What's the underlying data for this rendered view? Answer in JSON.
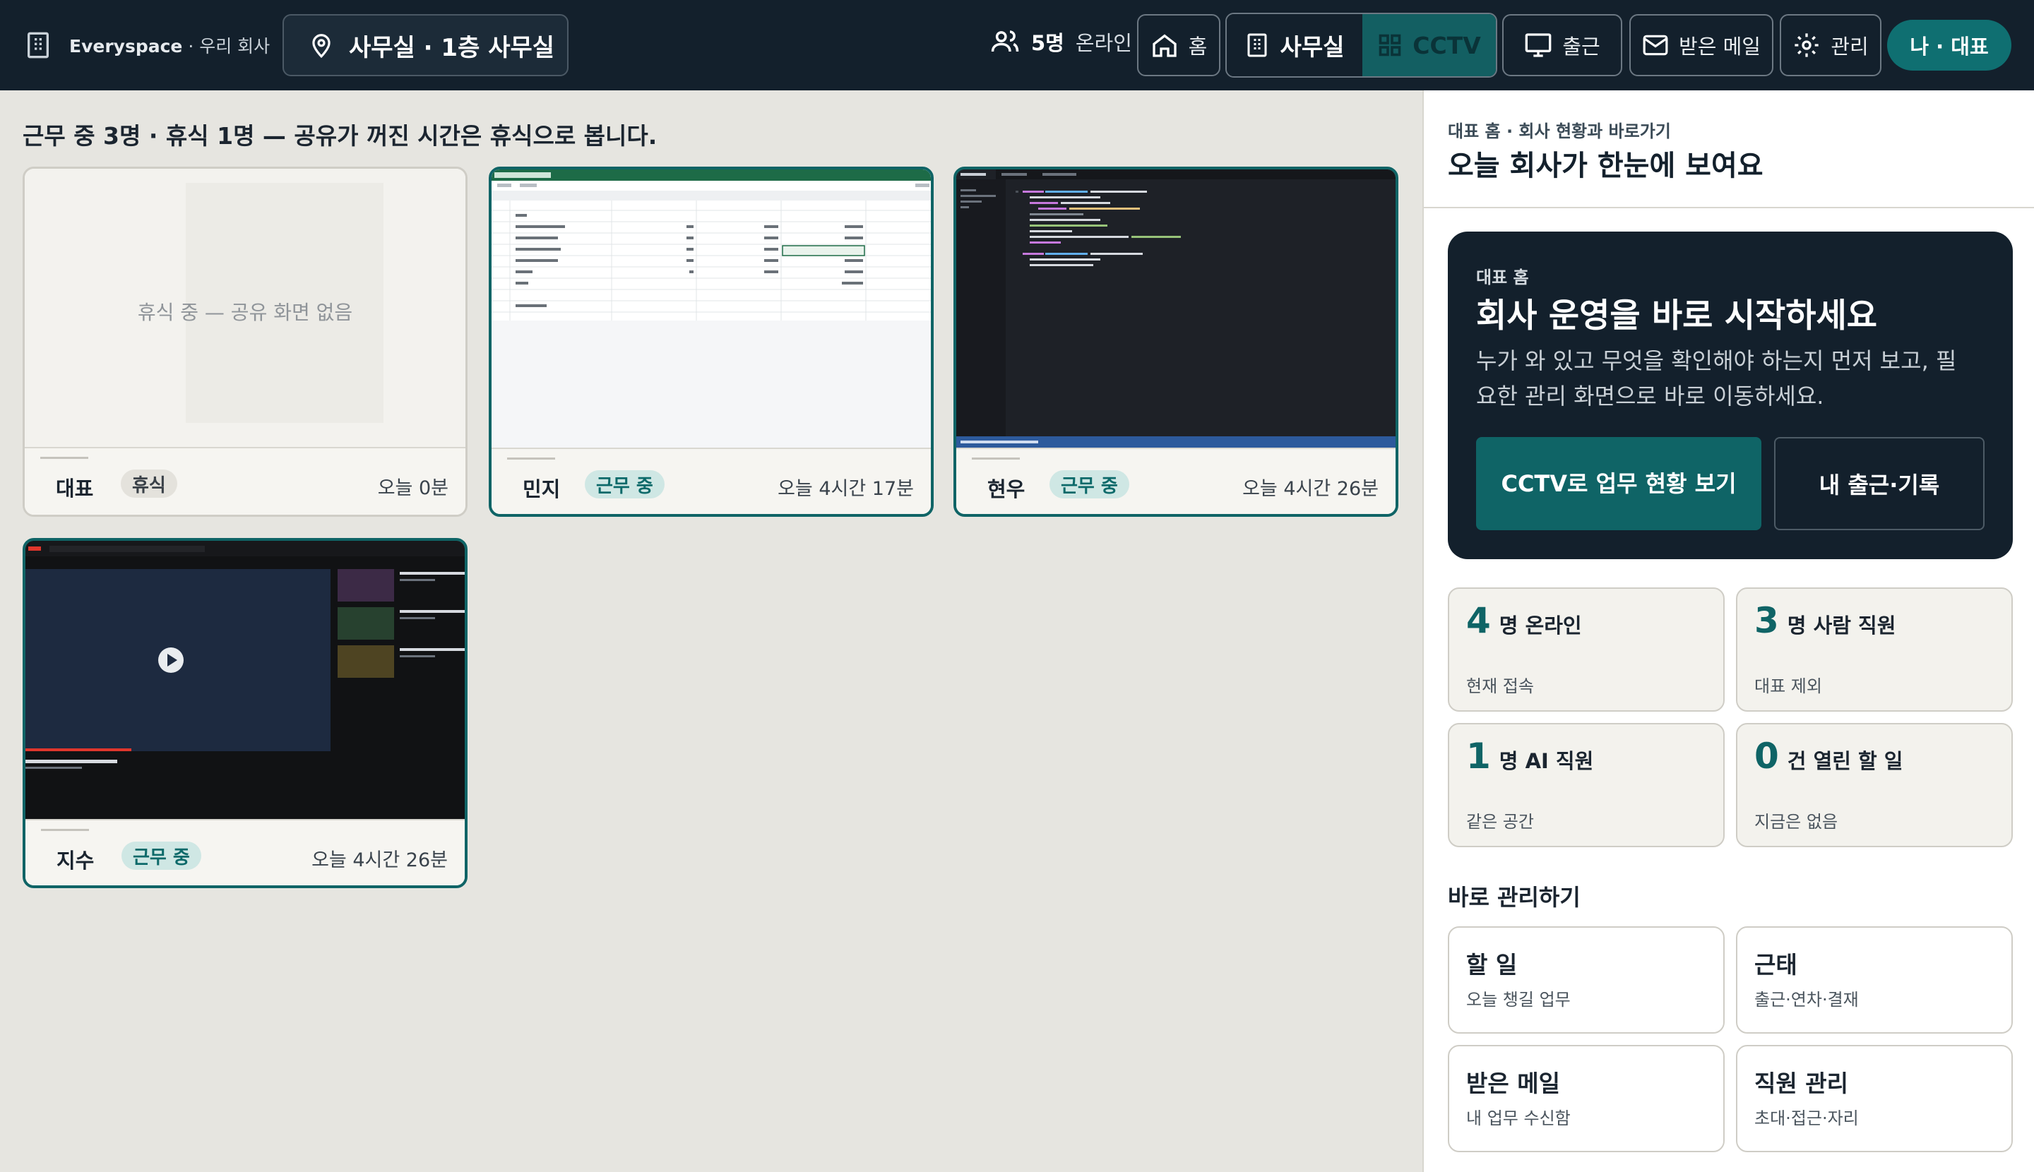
{
  "nav": {
    "brand_name": "Everyspace",
    "brand_sub": "· 우리 회사",
    "location_label": "사무실 · 1층 사무실",
    "online_count": "5명",
    "online_label": "온라인",
    "home_label": "홈",
    "office_label": "사무실",
    "cctv_label": "CCTV",
    "checkin_label": "출근",
    "inbox_label": "받은 메일",
    "admin_label": "관리",
    "me_label": "나 · 대표"
  },
  "main": {
    "headline": "근무 중 3명 · 휴식 1명 — 공유가 꺼진 시간은 휴식으로 봅니다.",
    "cards": [
      {
        "name": "대표",
        "status": "휴식",
        "time": "오늘 0분",
        "placeholder": "휴식 중 — 공유 화면 없음"
      },
      {
        "name": "민지",
        "status": "근무 중",
        "time": "오늘 4시간 17분"
      },
      {
        "name": "현우",
        "status": "근무 중",
        "time": "오늘 4시간 26분"
      },
      {
        "name": "지수",
        "status": "근무 중",
        "time": "오늘 4시간 26분"
      }
    ]
  },
  "side": {
    "breadcrumb": "대표 홈 · 회사 현황과 바로가기",
    "title": "오늘 회사가 한눈에 보여요",
    "hero": {
      "kicker": "대표 홈",
      "heading": "회사 운영을 바로 시작하세요",
      "desc": "누가 와 있고 무엇을 확인해야 하는지 먼저 보고, 필요한 관리 화면으로 바로 이동하세요.",
      "primary": "CCTV로 업무 현황 보기",
      "secondary": "내 출근·기록"
    },
    "stats": [
      {
        "value": "4",
        "label": "명 온라인",
        "sub": "현재 접속"
      },
      {
        "value": "3",
        "label": "명 사람 직원",
        "sub": "대표 제외"
      },
      {
        "value": "1",
        "label": "명 AI 직원",
        "sub": "같은 공간"
      },
      {
        "value": "0",
        "label": "건 열린 할 일",
        "sub": "지금은 없음"
      }
    ],
    "quick_title": "바로 관리하기",
    "quick": [
      {
        "title": "할 일",
        "sub": "오늘 챙길 업무"
      },
      {
        "title": "근태",
        "sub": "출근·연차·결재"
      },
      {
        "title": "받은 메일",
        "sub": "내 업무 수신함"
      },
      {
        "title": "직원 관리",
        "sub": "초대·접근·자리"
      }
    ]
  },
  "colors": {
    "nav_bg": "#13202c",
    "accent": "#0f6466",
    "page_bg": "#e6e5e0"
  }
}
